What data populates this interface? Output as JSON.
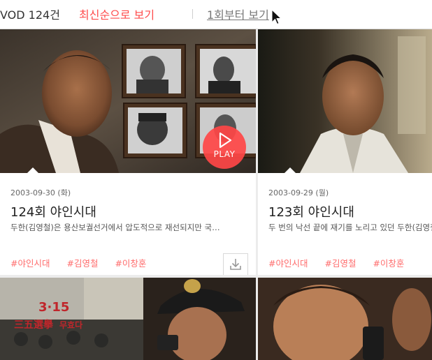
{
  "header": {
    "vod_count": "VOD 124건",
    "sort_latest": "최신순으로 보기",
    "sort_first": "1회부터 보기"
  },
  "episodes": [
    {
      "date": "2003-09-30 (화)",
      "title": "124회 야인시대",
      "description": "두한(김영철)은 용산보궐선거에서 압도적으로 재선되지만 국…",
      "tags": [
        "#야인시대",
        "#김영철",
        "#이창훈"
      ],
      "play_label": "PLAY",
      "download_icon": "download-icon"
    },
    {
      "date": "2003-09-29 (월)",
      "title": "123회 야인시대",
      "description": "두 번의 낙선 끝에 재기를 노리고 있던 두한(김영철)은 용산",
      "tags": [
        "#야인시대",
        "#김영철",
        "#이창훈"
      ]
    }
  ],
  "bottom_banner_text": [
    "3·15",
    "三五選擧",
    "무효다"
  ],
  "colors": {
    "accent": "#ff4b4b",
    "tag": "#ff6b6b"
  }
}
